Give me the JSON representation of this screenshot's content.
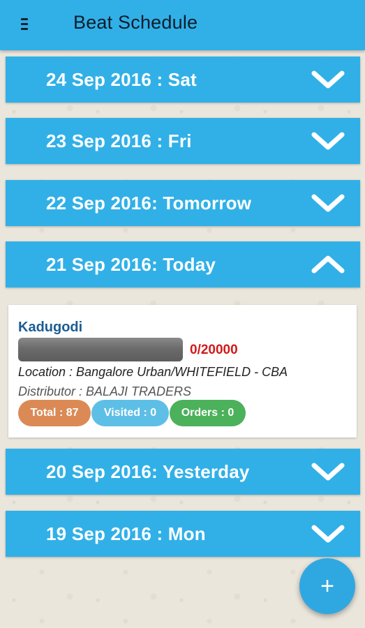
{
  "header": {
    "title": "Beat Schedule",
    "menu_icon": "menu-icon"
  },
  "colors": {
    "primary": "#31b0e7",
    "title_text": "#0c1d2b",
    "card_name": "#1c5d92",
    "target_text": "#d11a1a",
    "total_pill": "#db8a55",
    "visited_pill": "#5ebfe6",
    "orders_pill": "#4bb15b"
  },
  "sections": [
    {
      "label": "24 Sep 2016 : Sat",
      "expanded": false,
      "icon": "chevron-down-icon"
    },
    {
      "label": "23 Sep 2016 : Fri",
      "expanded": false,
      "icon": "chevron-down-icon"
    },
    {
      "label": "22 Sep 2016: Tomorrow",
      "expanded": false,
      "icon": "chevron-down-icon"
    },
    {
      "label": "21 Sep 2016: Today",
      "expanded": true,
      "icon": "chevron-up-icon"
    },
    {
      "label": "20 Sep 2016: Yesterday",
      "expanded": false,
      "icon": "chevron-down-icon"
    },
    {
      "label": "19 Sep 2016 : Mon",
      "expanded": false,
      "icon": "chevron-down-icon"
    }
  ],
  "today_card": {
    "name": "Kadugodi",
    "progress_text": "0/20000",
    "progress_fraction": 0,
    "location": "Location : Bangalore Urban/WHITEFIELD - CBA",
    "distributor": "Distributor : BALAJI TRADERS",
    "total": "Total : 87",
    "visited": "Visited : 0",
    "orders": "Orders : 0"
  },
  "fab": {
    "icon": "plus-icon",
    "label": "+"
  }
}
